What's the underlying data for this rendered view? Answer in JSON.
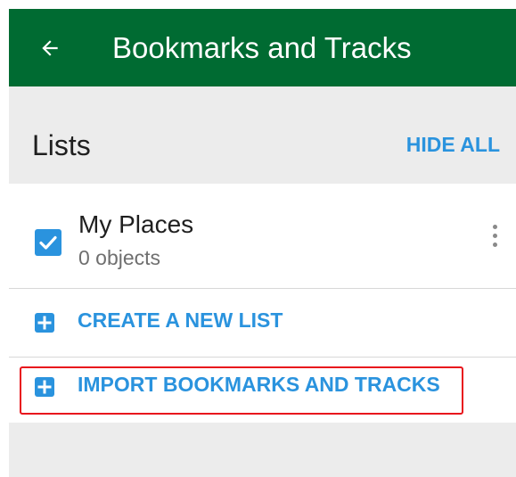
{
  "appbar": {
    "title": "Bookmarks and Tracks",
    "back_icon": "arrow-left-icon",
    "color": "#006b32"
  },
  "lists_section": {
    "title": "Lists",
    "hide_all_label": "HIDE ALL"
  },
  "lists": [
    {
      "name": "My Places",
      "count_label": "0 objects",
      "checked": true,
      "menu_icon": "more-vert-icon"
    }
  ],
  "actions": {
    "create_label": "CREATE A NEW LIST",
    "import_label": "IMPORT BOOKMARKS AND TRACKS",
    "icon": "plus-box-icon"
  },
  "colors": {
    "accent": "#2a93de",
    "highlight": "#e8141c",
    "background": "#ececec"
  }
}
